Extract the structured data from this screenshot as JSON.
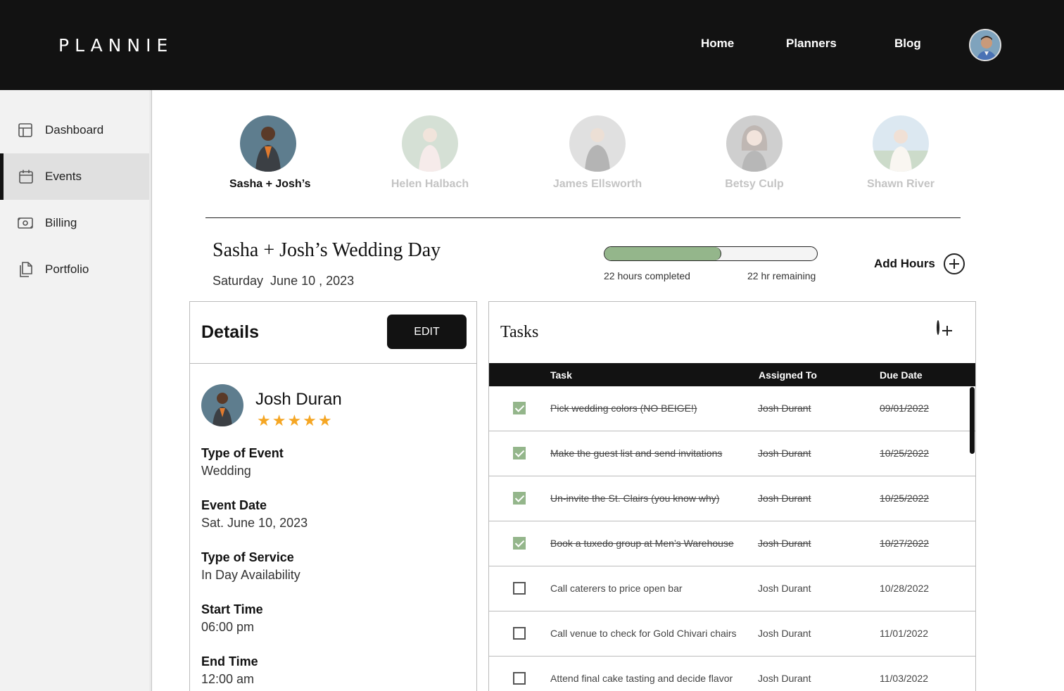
{
  "header": {
    "logo": "PLANNIE",
    "nav": [
      "Home",
      "Planners",
      "Blog"
    ]
  },
  "sidebar": {
    "items": [
      {
        "label": "Dashboard",
        "icon": "layout-icon"
      },
      {
        "label": "Events",
        "icon": "calendar-icon",
        "active": true
      },
      {
        "label": "Billing",
        "icon": "money-icon"
      },
      {
        "label": "Portfolio",
        "icon": "files-icon"
      }
    ]
  },
  "clients": [
    {
      "name": "Sasha + Josh’s",
      "active": true
    },
    {
      "name": "Helen Halbach"
    },
    {
      "name": "James Ellsworth"
    },
    {
      "name": "Betsy Culp"
    },
    {
      "name": "Shawn River"
    }
  ],
  "event": {
    "title": "Sasha + Josh’s Wedding Day",
    "date": "Saturday  June 10 , 2023",
    "progress_fraction": 0.55,
    "completed_text": "22 hours completed",
    "remaining_text": "22 hr remaining",
    "add_hours_label": "Add Hours"
  },
  "details": {
    "title": "Details",
    "edit_label": "EDIT",
    "planner_name": "Josh Duran",
    "rating": 5,
    "stars": "★★★★★",
    "fields": [
      {
        "label": "Type of Event",
        "value": "Wedding"
      },
      {
        "label": "Event Date",
        "value": "Sat. June 10, 2023"
      },
      {
        "label": "Type of Service",
        "value": "In Day Availability"
      },
      {
        "label": "Start Time",
        "value": "06:00 pm"
      },
      {
        "label": "End Time",
        "value": "12:00 am"
      }
    ]
  },
  "tasks": {
    "title": "Tasks",
    "columns": [
      "Task",
      "Assigned To",
      "Due Date"
    ],
    "rows": [
      {
        "task": "Pick wedding colors (NO BEIGE!)",
        "assigned": "Josh Durant",
        "due": "09/01/2022",
        "done": true
      },
      {
        "task": "Make the guest list and send invitations",
        "assigned": "Josh Durant",
        "due": "10/25/2022",
        "done": true
      },
      {
        "task": "Un-invite the St. Clairs (you know why)",
        "assigned": "Josh Durant",
        "due": "10/25/2022",
        "done": true
      },
      {
        "task": "Book a tuxedo group at Men’s Warehouse",
        "assigned": "Josh Durant",
        "due": "10/27/2022",
        "done": true
      },
      {
        "task": "Call caterers to price open bar",
        "assigned": "Josh Durant",
        "due": "10/28/2022",
        "done": false
      },
      {
        "task": "Call venue to check for Gold Chivari chairs",
        "assigned": "Josh Durant",
        "due": "11/01/2022",
        "done": false
      },
      {
        "task": "Attend final cake tasting and decide flavor",
        "assigned": "Josh Durant",
        "due": "11/03/2022",
        "done": false
      }
    ]
  },
  "colors": {
    "topbar": "#121212",
    "accent_green": "#94b68b",
    "star": "#f5a623",
    "sidebar_bg": "#f2f2f2",
    "sidebar_active": "#e0e0e0"
  }
}
